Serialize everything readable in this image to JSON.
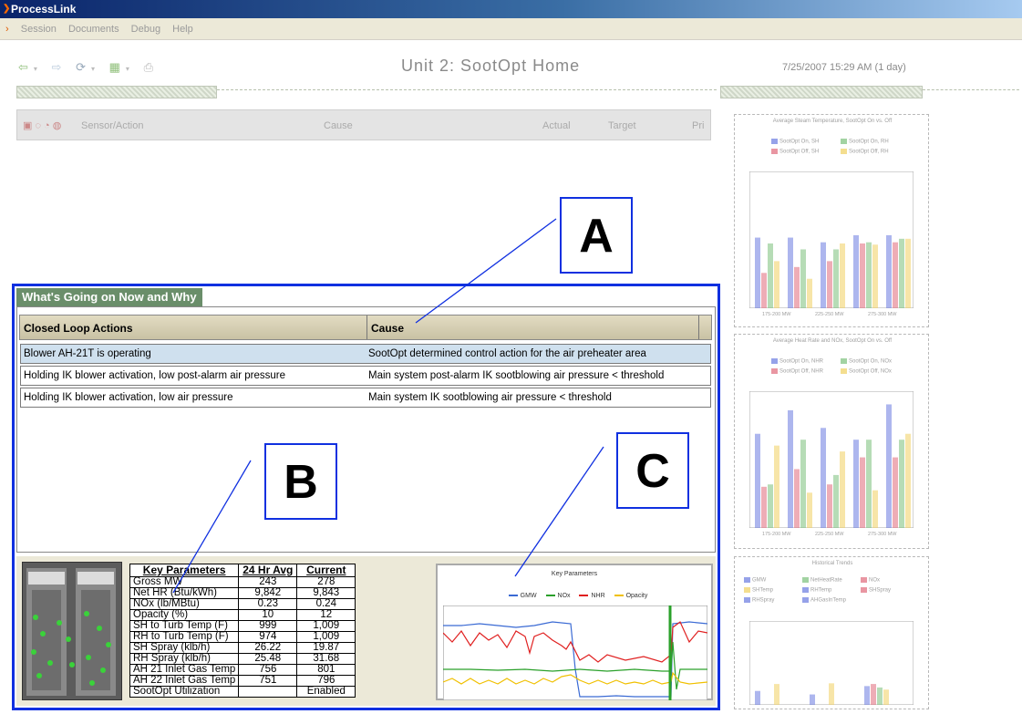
{
  "app": {
    "title": "ProcessLink"
  },
  "menu": [
    "Session",
    "Documents",
    "Debug",
    "Help"
  ],
  "toolbar": {
    "icons": [
      "back-icon",
      "forward-icon",
      "refresh-icon",
      "chart-icon",
      "print-icon"
    ]
  },
  "page": {
    "title": "Unit 2: SootOpt Home",
    "datetime": "7/25/2007 15:29 AM (1 day)"
  },
  "upper_panel": {
    "headers": [
      "Sensor/Action",
      "Cause",
      "Actual",
      "Target",
      "Pri"
    ]
  },
  "main_panel": {
    "section_title": "What's Going on Now and Why",
    "columns": [
      "Closed Loop Actions",
      "Cause"
    ],
    "rows": [
      {
        "action": "Blower AH-21T is operating",
        "cause": "SootOpt determined control action for the air preheater area",
        "selected": true
      },
      {
        "action": "Holding IK blower activation, low post-alarm air pressure",
        "cause": "Main system post-alarm IK sootblowing air pressure < threshold",
        "selected": false
      },
      {
        "action": "Holding IK blower activation, low air pressure",
        "cause": "Main system IK sootblowing air pressure < threshold",
        "selected": false
      }
    ]
  },
  "key_parameters": {
    "headers": [
      "Key Parameters",
      "24 Hr Avg",
      "Current"
    ],
    "rows": [
      [
        "Gross MW",
        "243",
        "278"
      ],
      [
        "Net HR (Btu/kWh)",
        "9,842",
        "9,843"
      ],
      [
        "NOx (lb/MBtu)",
        "0.23",
        "0.24"
      ],
      [
        "Opacity (%)",
        "10",
        "12"
      ],
      [
        "SH to Turb Temp (F)",
        "999",
        "1,009"
      ],
      [
        "RH to Turb Temp (F)",
        "974",
        "1,009"
      ],
      [
        "SH Spray (klb/h)",
        "26.22",
        "19.87"
      ],
      [
        "RH Spray (klb/h)",
        "25.48",
        "31.68"
      ],
      [
        "AH 21 Inlet Gas Temp",
        "756",
        "801"
      ],
      [
        "AH 22 Inlet Gas Temp",
        "751",
        "796"
      ],
      [
        "SootOpt Utilization",
        "",
        "Enabled"
      ]
    ]
  },
  "trend": {
    "title": "Key Parameters",
    "legend": [
      {
        "name": "GMW",
        "color": "#3a6ad4"
      },
      {
        "name": "NOx",
        "color": "#2aa02a"
      },
      {
        "name": "NHR",
        "color": "#e02020"
      },
      {
        "name": "Opacity",
        "color": "#f0c000"
      }
    ]
  },
  "callouts": {
    "a": "A",
    "b": "B",
    "c": "C"
  },
  "right_charts": [
    {
      "title": "Average Steam Temperature, SootOpt On vs. Off",
      "legend": [
        {
          "name": "SootOpt On, SH",
          "color": "#6a7ae0"
        },
        {
          "name": "SootOpt On, RH",
          "color": "#7ac07a"
        },
        {
          "name": "SootOpt Off, SH",
          "color": "#e06a7a"
        },
        {
          "name": "SootOpt Off, RH",
          "color": "#f0d060"
        }
      ],
      "xlabels": [
        "175-200 MW",
        "225-250 MW",
        "275-300 MW"
      ]
    },
    {
      "title": "Average Heat Rate and NOx, SootOpt On vs. Off",
      "legend": [
        {
          "name": "SootOpt On, NHR",
          "color": "#6a7ae0"
        },
        {
          "name": "SootOpt On, NOx",
          "color": "#7ac07a"
        },
        {
          "name": "SootOpt Off, NHR",
          "color": "#e06a7a"
        },
        {
          "name": "SootOpt Off, NOx",
          "color": "#f0d060"
        }
      ],
      "xlabels": [
        "175-200 MW",
        "225-250 MW",
        "275-300 MW"
      ]
    },
    {
      "title": "Historical Trends",
      "legend": [
        {
          "name": "GMW",
          "color": "#6a7ae0"
        },
        {
          "name": "NetHeatRate",
          "color": "#7ac07a"
        },
        {
          "name": "NOx",
          "color": "#e06a7a"
        },
        {
          "name": "SHTemp",
          "color": "#f0d060"
        },
        {
          "name": "RHTemp",
          "color": "#6a7ae0"
        },
        {
          "name": "SHSpray",
          "color": "#e06a7a"
        },
        {
          "name": "RHSpray",
          "color": "#6a7ae0"
        },
        {
          "name": "AHGasInTemp",
          "color": "#6a7ae0"
        }
      ],
      "xlabels": []
    }
  ]
}
